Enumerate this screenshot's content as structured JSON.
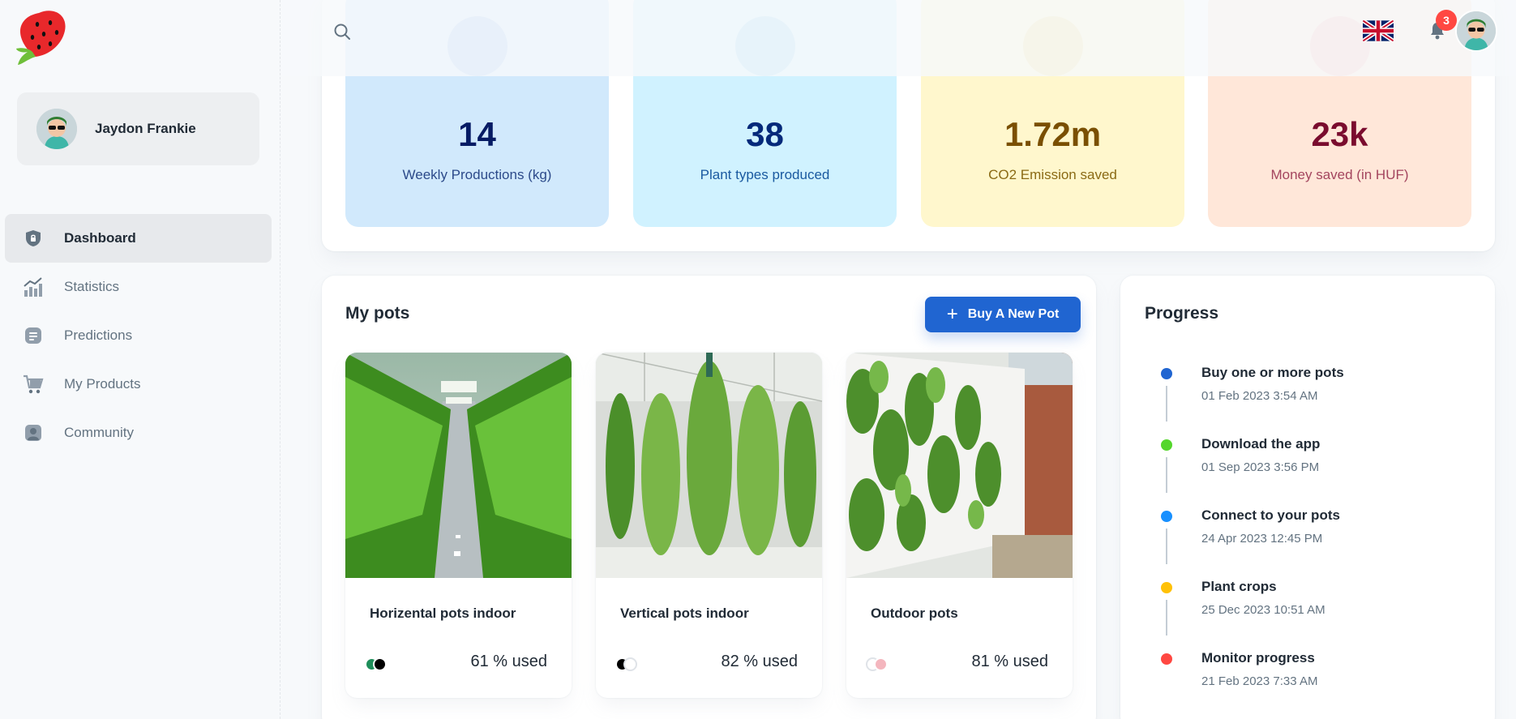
{
  "user": {
    "name": "Jaydon Frankie"
  },
  "nav": {
    "items": [
      {
        "label": "Dashboard",
        "icon": "dashboard-icon",
        "active": true
      },
      {
        "label": "Statistics",
        "icon": "statistics-icon",
        "active": false
      },
      {
        "label": "Predictions",
        "icon": "predictions-icon",
        "active": false
      },
      {
        "label": "My Products",
        "icon": "cart-icon",
        "active": false
      },
      {
        "label": "Community",
        "icon": "community-icon",
        "active": false
      }
    ]
  },
  "topbar": {
    "notifications_count": "3",
    "language": "English (UK flag)"
  },
  "stats": [
    {
      "value": "14",
      "label": "Weekly Productions (kg)",
      "bg": "#d1e9fc",
      "circle": "#a6c8f0",
      "value_color": "#061b64",
      "label_color": "#2c4a8a"
    },
    {
      "value": "38",
      "label": "Plant types produced",
      "bg": "#d0f2ff",
      "circle": "#9fd8f5",
      "value_color": "#04297a",
      "label_color": "#1a5aa0"
    },
    {
      "value": "1.72m",
      "label": "CO2 Emission saved",
      "bg": "#fff7cd",
      "circle": "#f5e39a",
      "value_color": "#7a4f01",
      "label_color": "#8a6a14"
    },
    {
      "value": "23k",
      "label": "Money saved (in HUF)",
      "bg": "#ffe7d9",
      "circle": "#f9c1bd",
      "value_color": "#7a0c2e",
      "label_color": "#a3455e"
    }
  ],
  "pots_section": {
    "title": "My pots",
    "buy_button": "Buy A New Pot",
    "pots": [
      {
        "name": "Horizental pots indoor",
        "usage": "61 % used",
        "dots": [
          "#1e8e5a",
          "#000000"
        ]
      },
      {
        "name": "Vertical pots indoor",
        "usage": "82 % used",
        "dots": [
          "#000000",
          "#ffffff"
        ]
      },
      {
        "name": "Outdoor pots",
        "usage": "81 % used",
        "dots": [
          "#ffffff",
          "#f4b6be"
        ]
      }
    ]
  },
  "progress": {
    "title": "Progress",
    "steps": [
      {
        "title": "Buy one or more pots",
        "date": "01 Feb 2023 3:54 AM",
        "color": "#2065d1"
      },
      {
        "title": "Download the app",
        "date": "01 Sep 2023 3:56 PM",
        "color": "#54d62c"
      },
      {
        "title": "Connect to your pots",
        "date": "24 Apr 2023 12:45 PM",
        "color": "#1890ff"
      },
      {
        "title": "Plant crops",
        "date": "25 Dec 2023 10:51 AM",
        "color": "#ffc107"
      },
      {
        "title": "Monitor progress",
        "date": "21 Feb 2023 7:33 AM",
        "color": "#ff4842"
      }
    ]
  }
}
